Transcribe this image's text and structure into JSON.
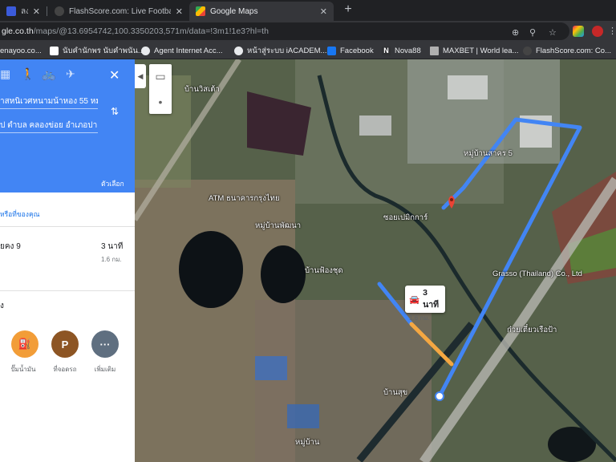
{
  "browser": {
    "tabs": [
      {
        "title": "ลงทะ",
        "active": false
      },
      {
        "title": "FlashScore.com: Live Football Sc",
        "active": false
      },
      {
        "title": "Google Maps",
        "active": true
      }
    ],
    "url_host": "gle.co.th",
    "url_path": "/maps/@13.6954742,100.3350203,571m/data=!3m1!1e3?hl=th",
    "bookmarks": [
      {
        "label": "enayoo.co..."
      },
      {
        "label": "นับคำนักพร นับคำพนัน..."
      },
      {
        "label": "Agent Internet Acc..."
      },
      {
        "label": "หน้าสู่ระบบ iACADEM..."
      },
      {
        "label": "Facebook"
      },
      {
        "label": "Nova88"
      },
      {
        "label": "MAXBET | World lea..."
      },
      {
        "label": "FlashScore.com: Co..."
      }
    ]
  },
  "panel": {
    "origin_text": "าสหนิเวศหนามน้าหอง 55 หมู่",
    "destination_text": "ป ตำบล คลองข่อย อำเภอปา",
    "options_label": "ตัวเลือก",
    "suggest_link": "หรือที่ของคุณ",
    "route": {
      "name": "ยคง 9",
      "time": "3 นาที",
      "distance": "1.6 กม."
    },
    "nearby_title": "ง",
    "pois": [
      {
        "label": "ปั๊มน้ำมัน",
        "glyph": "⛽",
        "color": "#f29d38"
      },
      {
        "label": "ที่จอดรถ",
        "glyph": "P",
        "color": "#8d5524"
      },
      {
        "label": "เพิ่มเติม",
        "glyph": "···",
        "color": "#5f6f80"
      }
    ]
  },
  "map": {
    "eta_time": "3 นาที",
    "eta_distance": "1.6 กม.",
    "labels": [
      {
        "text": "บ้านวิสเต้า",
        "name": "label-1"
      },
      {
        "text": "ATM ธนาคารกรุงไทย",
        "name": "label-2"
      },
      {
        "text": "หมู่บ้านพัฒนา",
        "name": "label-3"
      },
      {
        "text": "บ้านฟ้องชุด",
        "name": "label-4"
      },
      {
        "text": "หมู่บ้านสาคร 5",
        "name": "label-5"
      },
      {
        "text": "ซอยเปมิกการ์",
        "name": "label-6"
      },
      {
        "text": "Grasso (Thailand) Co., Ltd",
        "name": "label-7"
      },
      {
        "text": "ก๋วยเตี๋ยวเรือป้า",
        "name": "label-8"
      },
      {
        "text": "บ้านสุข",
        "name": "label-9"
      },
      {
        "text": "หมู่บ้าน",
        "name": "label-10"
      }
    ]
  },
  "colors": {
    "route": "#4285f4",
    "route_alt": "#f4a742",
    "panel_header": "#4285f4"
  }
}
